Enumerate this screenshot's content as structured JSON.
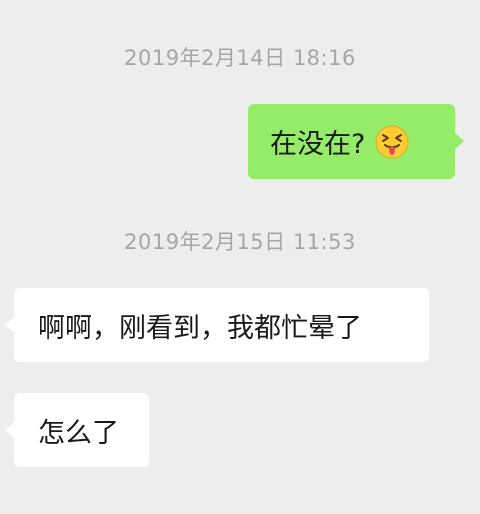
{
  "chat": {
    "messages": [
      {
        "timestamp": "2019年2月14日 18:16",
        "text": "在没在?",
        "sender": "self",
        "emoji": "grinning-squinting-tongue-emoji"
      },
      {
        "timestamp": "2019年2月15日 11:53",
        "text": "啊啊，刚看到，我都忙晕了",
        "sender": "other"
      },
      {
        "text": "怎么了",
        "sender": "other"
      }
    ]
  },
  "colors": {
    "background": "#ededed",
    "sent_bubble": "#95ec69",
    "received_bubble": "#ffffff",
    "timestamp_text": "#a6a6a6"
  }
}
